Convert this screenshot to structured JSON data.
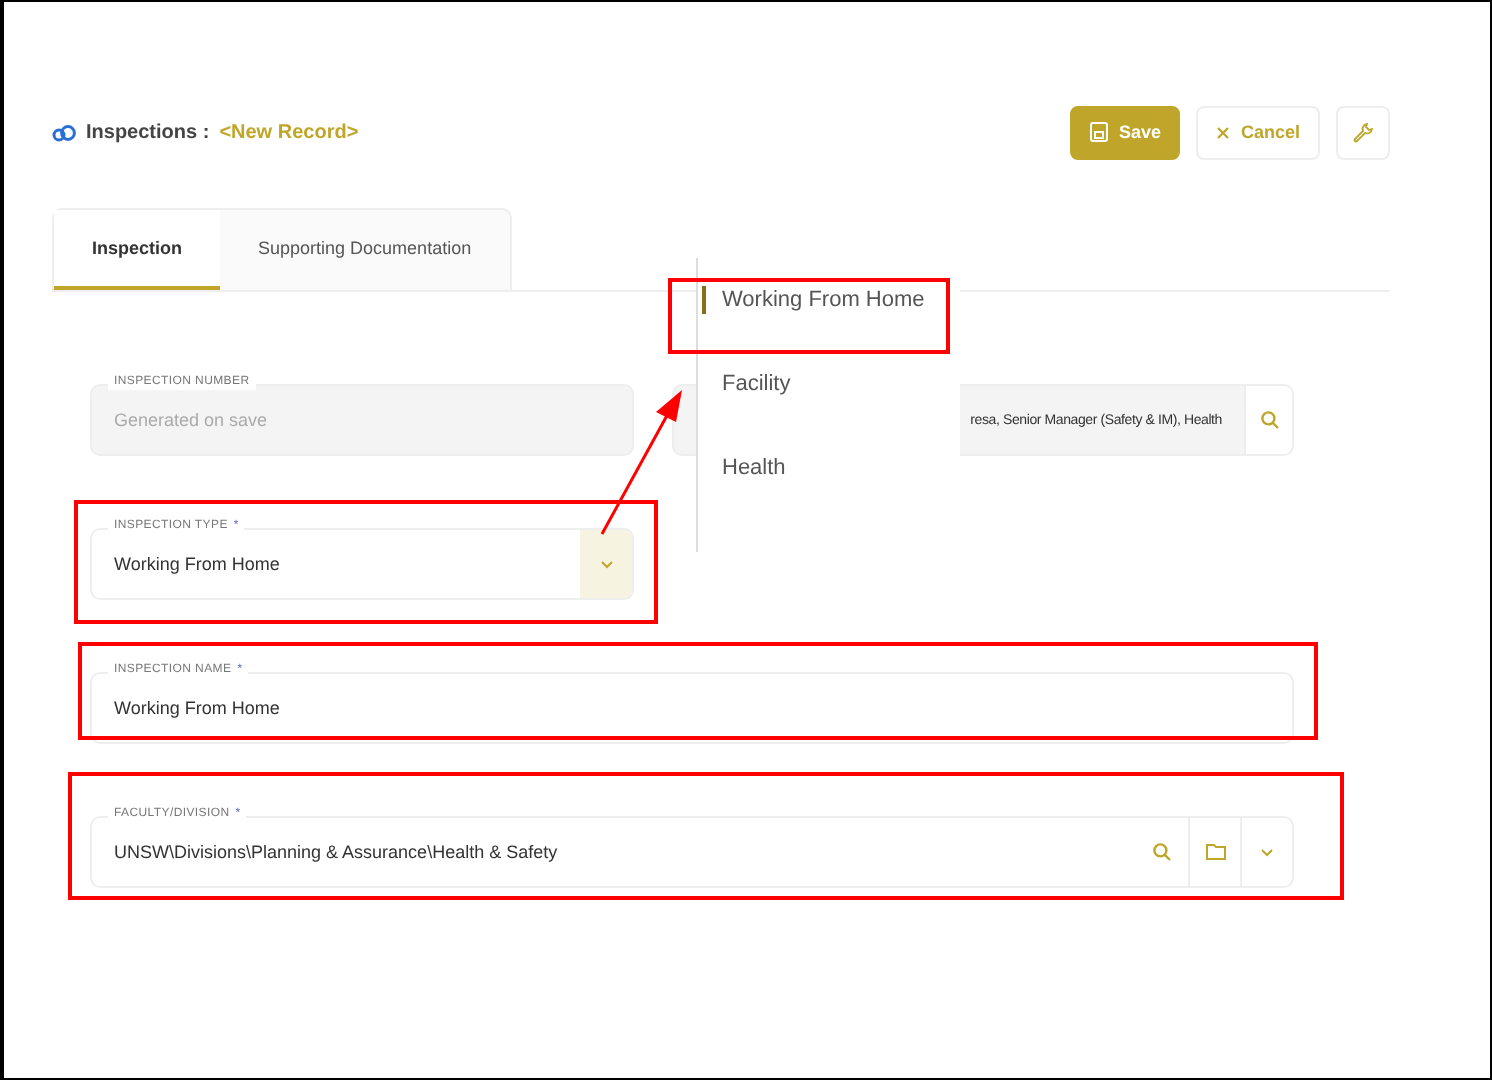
{
  "header": {
    "module": "Inspections :",
    "record": "<New Record>"
  },
  "buttons": [
    {
      "kind": "save",
      "label": "Save"
    },
    {
      "kind": "cancel",
      "label": "Cancel"
    },
    {
      "kind": "tool"
    }
  ],
  "tabs": [
    {
      "label": "Inspection",
      "selected": true
    },
    {
      "label": "Supporting Documentation",
      "selected": false
    }
  ],
  "fields": {
    "inspection_number": {
      "label": "INSPECTION NUMBER",
      "placeholder": "Generated on save",
      "disabled": true
    },
    "assigned": {
      "value": "resa, Senior Manager (Safety & IM), Health"
    },
    "inspection_type": {
      "label": "INSPECTION TYPE",
      "required_mark": "*",
      "value": "Working From Home"
    },
    "inspection_name": {
      "label": "INSPECTION NAME",
      "required_mark": "*",
      "value": "Working From Home"
    },
    "faculty": {
      "label": "FACULTY/DIVISION",
      "required_mark": "*",
      "value": "UNSW\\Divisions\\Planning & Assurance\\Health & Safety"
    }
  },
  "dropdown": [
    {
      "label": "Working From Home",
      "selected": true
    },
    {
      "label": "Facility",
      "selected": false
    },
    {
      "label": "Health",
      "selected": false
    }
  ]
}
